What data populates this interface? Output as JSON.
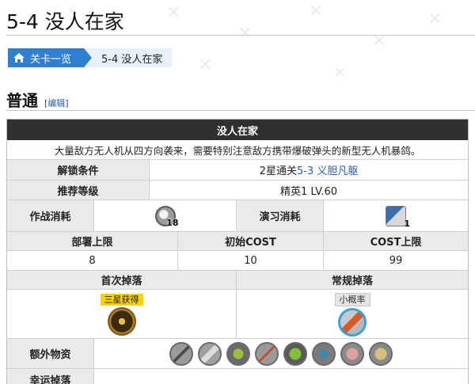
{
  "page": {
    "title": "5-4 没人在家"
  },
  "breadcrumb": {
    "home_label": "关卡一览",
    "current_label": "5-4 没人在家"
  },
  "section": {
    "heading": "普通",
    "edit_open": "[",
    "edit_label": "编辑",
    "edit_close": "]"
  },
  "infobox": {
    "title": "没人在家",
    "description": "大量敌方无人机从四方向袭来，需要特别注意敌方携带爆破弹头的新型无人机暴鸽。",
    "unlock": {
      "label": "解锁条件",
      "prefix": "2星通关",
      "link": "5-3 义胆凡躯"
    },
    "recommend": {
      "label": "推荐等级",
      "value": "精英1 LV.60"
    },
    "combat_cost": {
      "label": "作战消耗",
      "count": "18",
      "icon": "sanity-icon"
    },
    "practice_cost": {
      "label": "演习消耗",
      "count": "1",
      "icon": "practice-plan-icon"
    },
    "stats_headers": [
      "部署上限",
      "初始COST",
      "COST上限"
    ],
    "stats_values": [
      "8",
      "10",
      "99"
    ],
    "first_drop": {
      "label": "首次掉落",
      "tag": "三星获得",
      "icon": "orundum-icon"
    },
    "regular_drop": {
      "label": "常规掉落",
      "tag": "小概率",
      "icon": "device-material-icon"
    },
    "extra": {
      "label": "额外物资",
      "items": [
        "metal-rod-icon",
        "polyketone-icon",
        "battery-icon",
        "syringe-icon",
        "chip-icon",
        "gear-material-icon",
        "brick-icon",
        "ore-icon"
      ]
    },
    "lucky_drop": {
      "label": "幸运掉落"
    }
  },
  "colors": {
    "accent": "#2f7fd3",
    "link": "#2a5db0",
    "header_dark": "#303030",
    "tag_yellow": "#f6d200"
  }
}
